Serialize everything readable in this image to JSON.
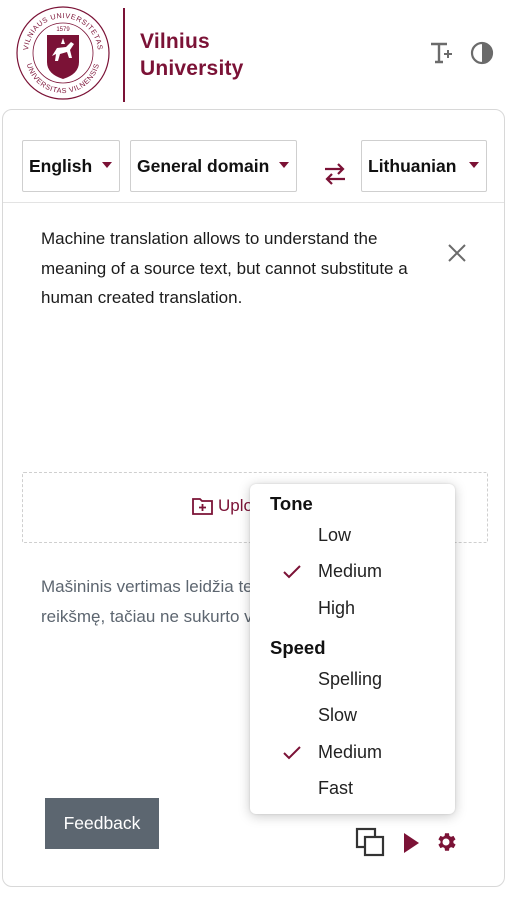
{
  "header": {
    "seal_text_top": "VILNIAUS UNIVERSITETAS",
    "seal_text_bottom": "UNIVERSITAS VILNENSIS",
    "seal_year": "1579",
    "name_line1": "Vilnius",
    "name_line2": "University",
    "icons": [
      "text-size-icon",
      "contrast-icon"
    ],
    "brand_color": "#7b1236"
  },
  "languages": {
    "source": "English",
    "domain": "General domain",
    "target": "Lithuanian"
  },
  "source_text": "Machine translation allows to understand the meaning of a source text, but cannot substitute a human created translation.",
  "upload": {
    "label": "Uplo"
  },
  "target_text": "Mašininis vertimas leidžia teksto reikšmę, tačiau ne sukurto vertimo.",
  "feedback_label": "Feedback",
  "menu": {
    "tone": {
      "heading": "Tone",
      "options": [
        "Low",
        "Medium",
        "High"
      ],
      "selected": "Medium"
    },
    "speed": {
      "heading": "Speed",
      "options": [
        "Spelling",
        "Slow",
        "Medium",
        "Fast"
      ],
      "selected": "Medium"
    }
  }
}
